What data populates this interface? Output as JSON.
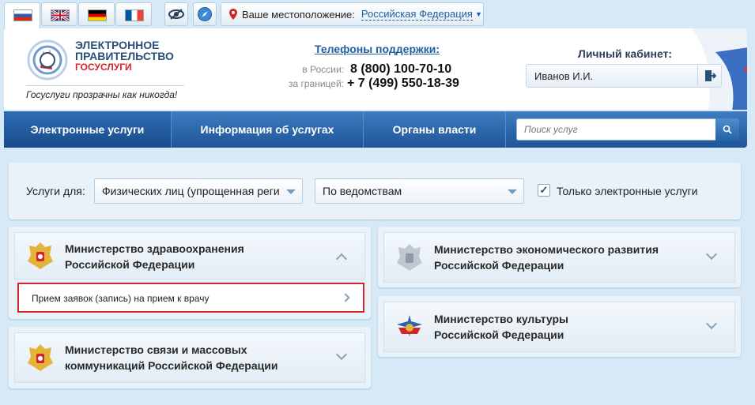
{
  "topbar": {
    "flags": [
      {
        "name": "russian",
        "colors": [
          "#ffffff",
          "#2a5fb3",
          "#d52b1e"
        ]
      },
      {
        "name": "english"
      },
      {
        "name": "german"
      },
      {
        "name": "french"
      }
    ],
    "location_label": "Ваше местоположение:",
    "location_value": "Российская Федерация"
  },
  "header": {
    "logo_line1": "ЭЛЕКТРОННОЕ",
    "logo_line2": "ПРАВИТЕЛЬСТВО",
    "logo_line3": "ГОСУСЛУГИ",
    "slogan": "Госуслуги прозрачны как никогда!",
    "phones_title": "Телефоны поддержки:",
    "phone_ru_label": "в России:",
    "phone_ru": "8 (800) 100-70-10",
    "phone_abroad_label": "за границей:",
    "phone_abroad": "+ 7 (499) 550-18-39",
    "cabinet_title": "Личный кабинет:",
    "cabinet_user": "Иванов И.И."
  },
  "nav": {
    "tabs": [
      "Электронные услуги",
      "Информация об услугах",
      "Органы власти"
    ],
    "search_placeholder": "Поиск услуг"
  },
  "filters": {
    "label": "Услуги для:",
    "audience": "Физических лиц (упрощенная реги",
    "grouping": "По ведомствам",
    "only_electronic": "Только электронные услуги",
    "only_electronic_checked": true
  },
  "ministries": [
    {
      "line1": "Министерство здравоохранения",
      "line2": "Российской Федерации",
      "expanded": true,
      "service": "Прием заявок (запись) на прием к врачу"
    },
    {
      "line1": "Министерство экономического развития",
      "line2": "Российской Федерации",
      "expanded": false
    },
    {
      "line1": "Министерство культуры",
      "line2": "Российской Федерации",
      "expanded": false
    },
    {
      "line1": "Министерство связи и массовых",
      "line2": "коммуникаций Российской Федерации",
      "expanded": false
    }
  ],
  "colors": {
    "accent": "#1f5fa0",
    "nav": "#2a64a8",
    "highlight": "#d3232b"
  }
}
